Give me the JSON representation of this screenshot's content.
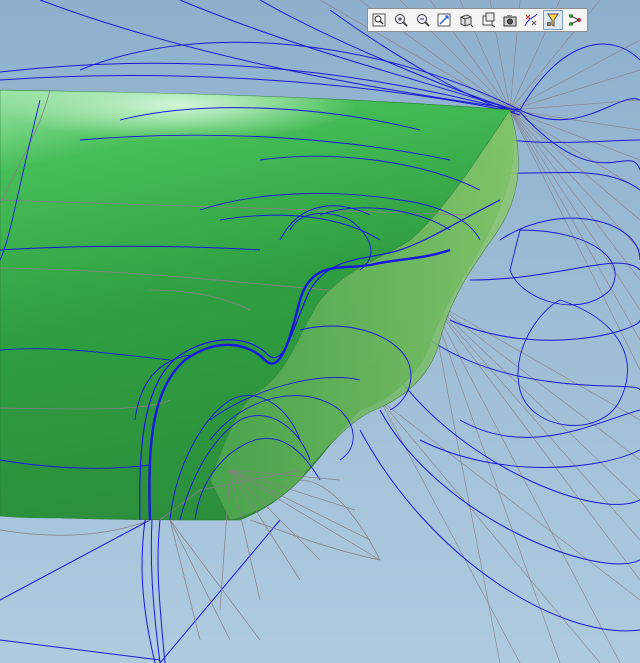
{
  "viewport": {
    "background_top": "#8fb2cf",
    "background_bottom": "#a9c7dc",
    "surface_color": "#37b24d",
    "surface_highlight": "#bff0c6",
    "curve_color_primary": "#1717d6",
    "curve_color_secondary": "#8a7f86"
  },
  "toolbar": {
    "buttons": [
      {
        "icon": "zoom-window-icon",
        "active": false
      },
      {
        "icon": "zoom-in-icon",
        "active": false
      },
      {
        "icon": "zoom-out-icon",
        "active": false
      },
      {
        "icon": "view-fit-icon",
        "active": false
      },
      {
        "icon": "shaded-cube-icon",
        "active": false
      },
      {
        "icon": "view-orientation-icon",
        "active": false
      },
      {
        "icon": "snapshot-icon",
        "active": false
      },
      {
        "icon": "curvature-analysis-icon",
        "active": false
      },
      {
        "icon": "display-filter-icon",
        "active": true
      },
      {
        "icon": "connector-icon",
        "active": false
      }
    ]
  }
}
